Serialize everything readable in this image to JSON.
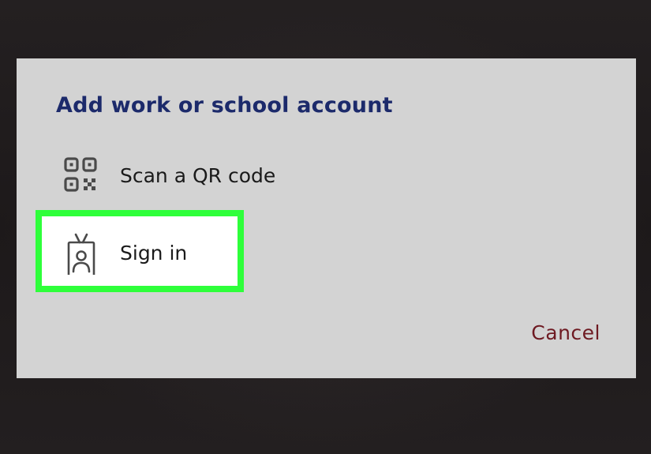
{
  "dialog": {
    "title": "Add work or school account",
    "options": [
      {
        "label": "Scan a QR code",
        "icon": "qr-code-icon",
        "highlighted": false
      },
      {
        "label": "Sign in",
        "icon": "id-badge-icon",
        "highlighted": true
      }
    ],
    "cancel_label": "Cancel"
  },
  "colors": {
    "title": "#1c2a6b",
    "cancel": "#6e1a22",
    "highlight_border": "#2eff3a",
    "dialog_background": "#d3d3d3"
  }
}
